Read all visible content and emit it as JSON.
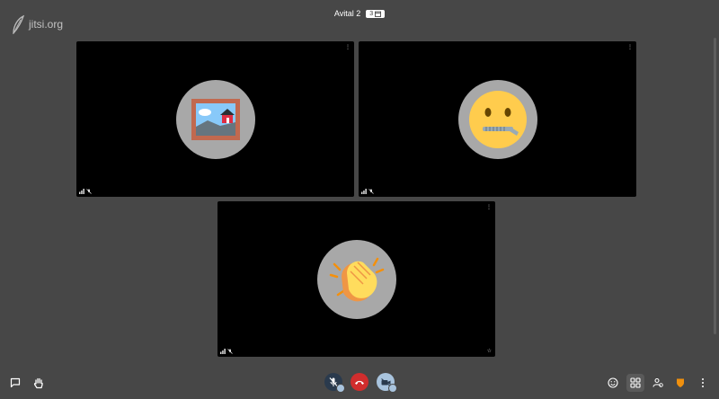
{
  "logo": {
    "text": "jitsi.org",
    "icon": "jitsi-leaf-icon"
  },
  "header": {
    "room_name": "Avital 2",
    "participant_count": "3",
    "count_icon": "calendar-icon"
  },
  "tiles": [
    {
      "avatar_icon": "framed-picture-emoji-icon",
      "menu_icon": "more-vertical-icon",
      "status_icons": [
        "signal-icon",
        "mic-muted-icon"
      ]
    },
    {
      "avatar_icon": "zipper-mouth-face-emoji-icon",
      "menu_icon": "more-vertical-icon",
      "status_icons": [
        "signal-icon",
        "mic-muted-icon"
      ]
    },
    {
      "avatar_icon": "clapping-hands-emoji-icon",
      "menu_icon": "more-vertical-icon",
      "status_icons": [
        "signal-icon",
        "mic-muted-icon"
      ],
      "extra_icon": "star-icon"
    }
  ],
  "toolbar": {
    "left": [
      "chat-icon",
      "raise-hand-icon"
    ],
    "center": [
      "microphone-muted-icon",
      "hangup-icon",
      "camera-off-icon"
    ],
    "right": [
      "reactions-icon",
      "tile-view-icon",
      "participants-icon",
      "security-shield-icon",
      "more-options-icon"
    ]
  },
  "colors": {
    "background": "#474747",
    "tile": "#000000",
    "avatar": "#a8a8a8",
    "hangup": "#d12d2d",
    "shield": "#f0900e",
    "tile_view_active": "#5a5a5a"
  }
}
